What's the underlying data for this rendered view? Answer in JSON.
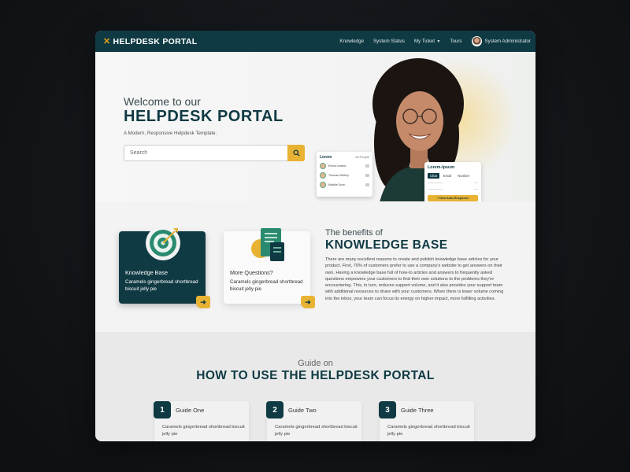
{
  "nav": {
    "logo_text": "HELPDESK PORTAL",
    "links": [
      "Knowledge",
      "System Status",
      "My Ticket",
      "Tours"
    ],
    "user": "System Administrator"
  },
  "hero": {
    "welcome": "Welcome to our",
    "title": "HELPDESK PORTAL",
    "tagline": "A Modern, Responsive Helpdesk Template.",
    "search_placeholder": "Search",
    "people_card": {
      "title": "Lorem",
      "count": "15 People",
      "people": [
        "Emma Ireland",
        "Thomas Whitley",
        "Maddie Dunn"
      ]
    },
    "chat_card": {
      "title": "Lorem-Ipsum",
      "tabs": [
        "Chat",
        "Email",
        "Number"
      ],
      "button": "+ New Auto-Response"
    }
  },
  "features": [
    {
      "title": "Knowledge Base",
      "desc": "Caramels gingerbread shortbread biscuit jelly pie",
      "icon": "target-icon"
    },
    {
      "title": "More Questions?",
      "desc": "Caramels gingerbread shortbread biscuit jelly pie",
      "icon": "document-icon"
    }
  ],
  "benefits": {
    "pre": "The benefits of",
    "title": "KNOWLEDGE BASE",
    "body": "There are many excellent reasons to create and publish knowledge base articles for your product. First, 70% of customers prefer to use a company's website to get answers on their own. Having a knowledge base full of how-to articles and answers to frequently asked questions empowers your customers to find their own solutions to the problems they're encountering. This, in turn, reduces support volume, and it also provides your support team with additional resources to share with your customers. When there is lower volume coming into the inbox, your team can focus its energy on higher impact, more fulfilling activities."
  },
  "guide": {
    "pre": "Guide on",
    "title": "HOW TO USE THE HELPDESK PORTAL",
    "steps": [
      {
        "num": "1",
        "title": "Guide One",
        "desc": "Caramels gingerbread shortbread biscuit jelly pie"
      },
      {
        "num": "2",
        "title": "Guide Two",
        "desc": "Caramels gingerbread shortbread biscuit jelly pie"
      },
      {
        "num": "3",
        "title": "Guide Three",
        "desc": "Caramels gingerbread shortbread biscuit jelly pie"
      }
    ]
  },
  "colors": {
    "primary": "#0f3a43",
    "accent": "#e8b233",
    "background": "#f3f3f3"
  }
}
